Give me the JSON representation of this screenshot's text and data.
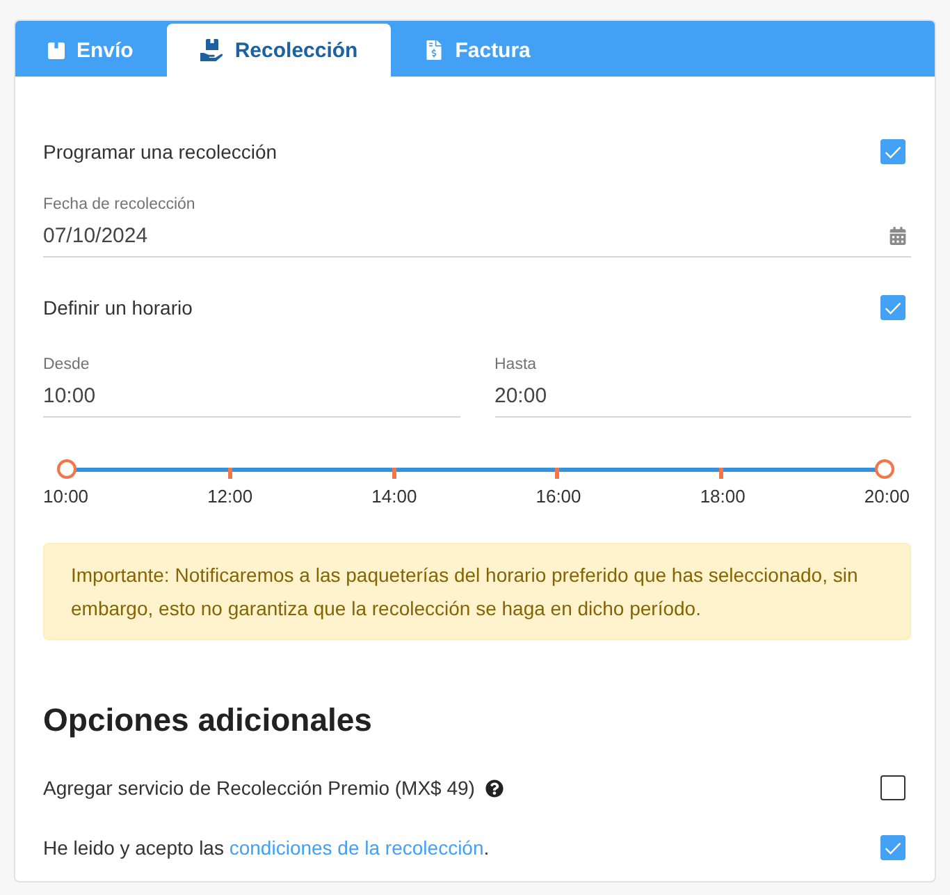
{
  "tabs": [
    {
      "label": "Envío",
      "selected": false
    },
    {
      "label": "Recolección",
      "selected": true
    },
    {
      "label": "Factura",
      "selected": false
    }
  ],
  "schedule_pickup": {
    "label": "Programar una recolección",
    "checked": true
  },
  "pickup_date": {
    "label": "Fecha de recolección",
    "value": "07/10/2024"
  },
  "define_schedule": {
    "label": "Definir un horario",
    "checked": true
  },
  "time_fields": [
    {
      "label": "Desde",
      "value": "10:00"
    },
    {
      "label": "Hasta",
      "value": "20:00"
    }
  ],
  "time_slider": {
    "thumbs": [
      {
        "level": 0
      },
      {
        "level": 1
      }
    ],
    "tick_labels": [
      "10:00",
      "12:00",
      "14:00",
      "16:00",
      "18:00",
      "20:00"
    ]
  },
  "notice": {
    "text": "Importante: Notificaremos a las paqueterías del horario preferido que has seleccionado, sin embargo, esto no garantiza que la recolección se haga en dicho período."
  },
  "additional_options": {
    "title": "Opciones adicionales",
    "options": [
      {
        "kind": "help",
        "label": "Agregar servicio de Recolección Premio (MX$ 49)",
        "checked": false
      },
      {
        "kind": "link",
        "label": "He leido y acepto las",
        "link": "condiciones de la recolección",
        "suffix": ".",
        "checked": true
      }
    ]
  }
}
